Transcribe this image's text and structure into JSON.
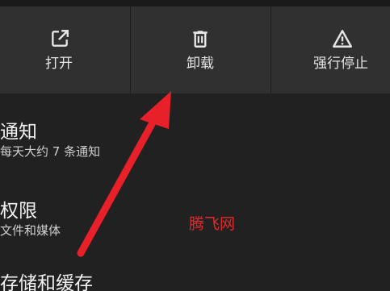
{
  "actions": {
    "open": {
      "label": "打开",
      "icon": "open-external-icon"
    },
    "uninstall": {
      "label": "卸载",
      "icon": "trash-icon"
    },
    "force_stop": {
      "label": "强行停止",
      "icon": "warning-icon"
    }
  },
  "settings": {
    "notifications": {
      "title": "通知",
      "summary": "每天大约 7 条通知"
    },
    "permissions": {
      "title": "权限",
      "summary": "文件和媒体"
    },
    "storage": {
      "title": "存储和缓存"
    }
  },
  "watermark": "腾飞网",
  "colors": {
    "background": "#212121",
    "action_bar": "#303030",
    "annotation_arrow": "#e8202a",
    "watermark": "#e02a2a"
  }
}
